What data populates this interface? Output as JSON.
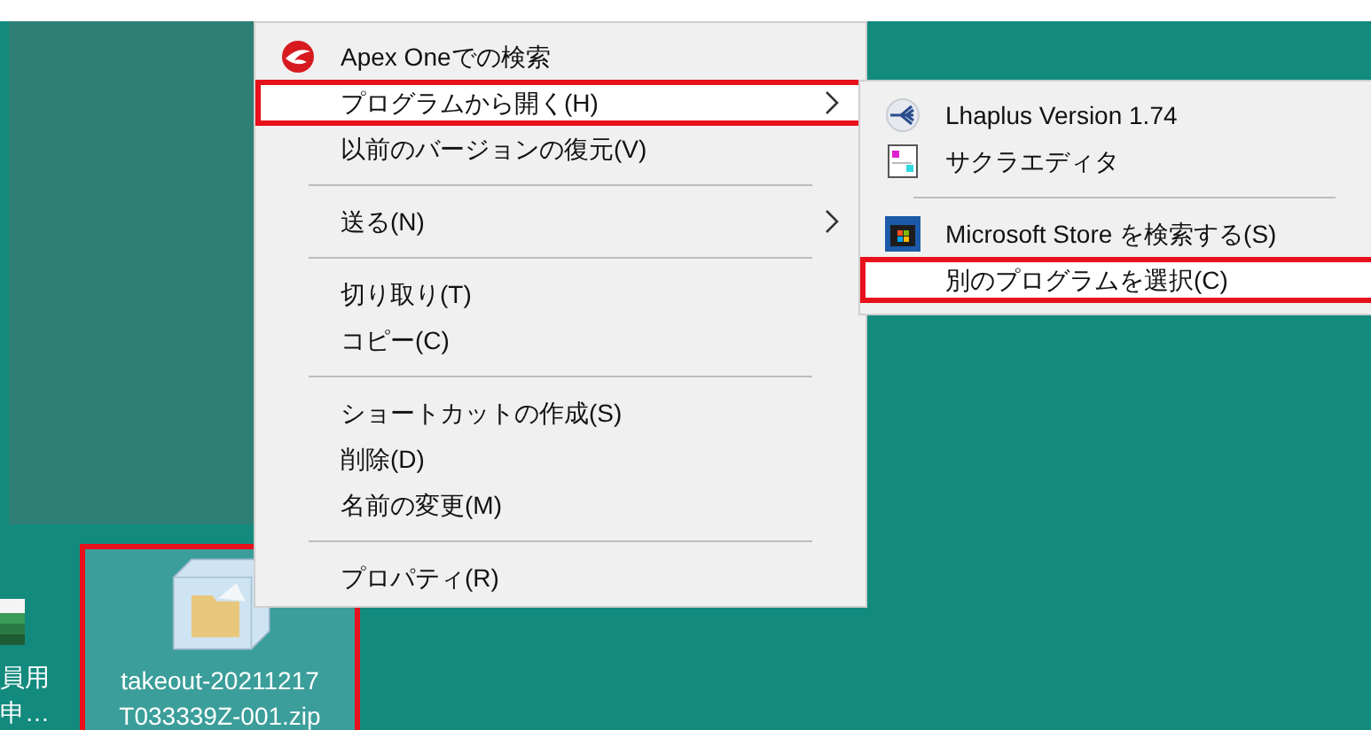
{
  "context_menu": {
    "items": [
      {
        "kind": "item",
        "label": "Apex Oneでの検索",
        "submenu": false,
        "highlighted": false
      },
      {
        "kind": "item",
        "label": "プログラムから開く(H)",
        "submenu": true,
        "highlighted": true
      },
      {
        "kind": "item",
        "label": "以前のバージョンの復元(V)",
        "submenu": false,
        "highlighted": false
      },
      {
        "kind": "separator"
      },
      {
        "kind": "item",
        "label": "送る(N)",
        "submenu": true,
        "highlighted": false
      },
      {
        "kind": "separator"
      },
      {
        "kind": "item",
        "label": "切り取り(T)",
        "submenu": false,
        "highlighted": false
      },
      {
        "kind": "item",
        "label": "コピー(C)",
        "submenu": false,
        "highlighted": false
      },
      {
        "kind": "separator"
      },
      {
        "kind": "item",
        "label": "ショートカットの作成(S)",
        "submenu": false,
        "highlighted": false
      },
      {
        "kind": "item",
        "label": "削除(D)",
        "submenu": false,
        "highlighted": false
      },
      {
        "kind": "item",
        "label": "名前の変更(M)",
        "submenu": false,
        "highlighted": false
      },
      {
        "kind": "separator"
      },
      {
        "kind": "item",
        "label": "プロパティ(R)",
        "submenu": false,
        "highlighted": false
      }
    ]
  },
  "submenu": {
    "items": [
      {
        "kind": "item",
        "label": "Lhaplus Version 1.74",
        "highlighted": false
      },
      {
        "kind": "item",
        "label": "サクラエディタ",
        "highlighted": false
      },
      {
        "kind": "separator"
      },
      {
        "kind": "item",
        "label": "Microsoft Store を検索する(S)",
        "highlighted": false
      },
      {
        "kind": "item",
        "label": "別のプログラムを選択(C)",
        "highlighted": true
      }
    ]
  },
  "desktop": {
    "icons": [
      {
        "lines": [
          "員用",
          "申…"
        ],
        "selected": false
      },
      {
        "lines": [
          "takeout-20211217",
          "T033339Z-001.zip"
        ],
        "selected": true
      }
    ]
  }
}
